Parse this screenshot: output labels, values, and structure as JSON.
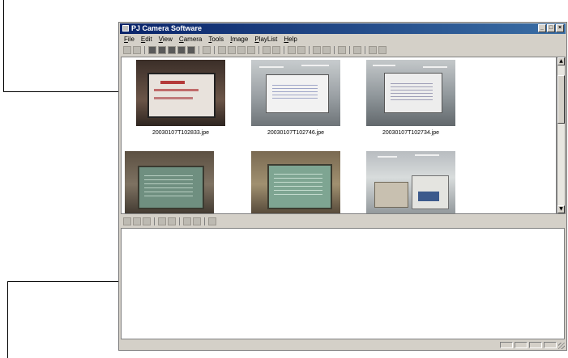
{
  "window": {
    "title": "PJ Camera Software",
    "menus": [
      "File",
      "Edit",
      "View",
      "Camera",
      "Tools",
      "Image",
      "PlayList",
      "Help"
    ],
    "controls": [
      "_",
      "□",
      "×"
    ]
  },
  "thumbnails": [
    {
      "caption": "20030107T102833.jpe"
    },
    {
      "caption": "20030107T102746.jpe"
    },
    {
      "caption": "20030107T102734.jpe"
    },
    {
      "caption": ""
    },
    {
      "caption": ""
    },
    {
      "caption": ""
    }
  ],
  "scrollbar": {
    "up": "▲",
    "down": "▼"
  },
  "colors": {
    "titlebar": "#0a246a",
    "chrome": "#d4d0c8"
  }
}
